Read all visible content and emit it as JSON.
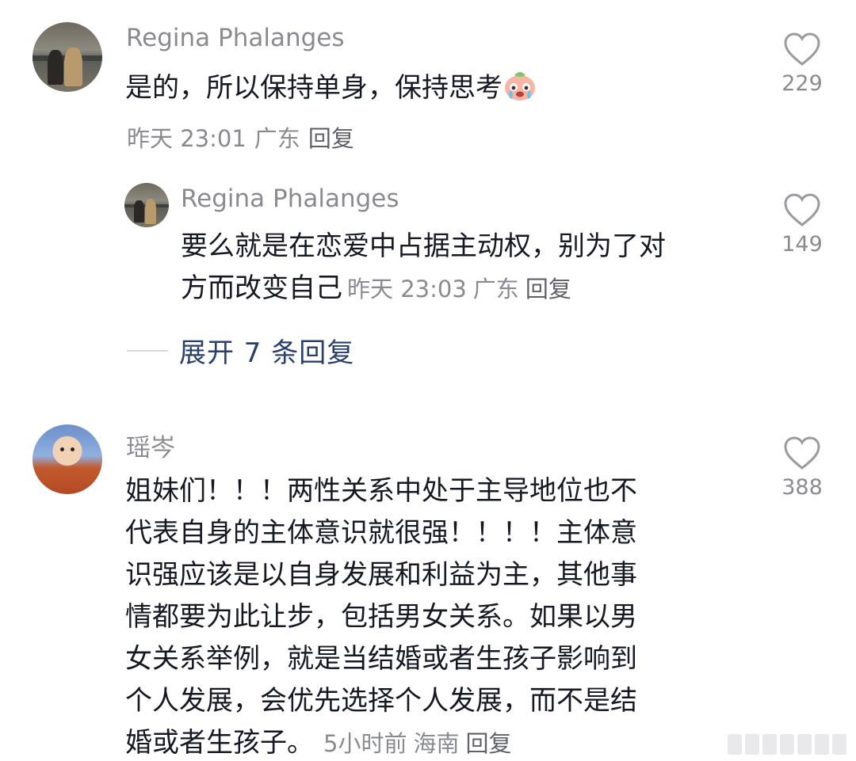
{
  "comments": [
    {
      "username": "Regina Phalanges",
      "text": "是的，所以保持单身，保持思考",
      "emoji": "crying-face-emoji",
      "time": "昨天 23:01",
      "location": "广东",
      "reply_label": "回复",
      "likes": "229",
      "replies": [
        {
          "username": "Regina Phalanges",
          "text_line1": "要么就是在恋爱中占据主动权，别为了对",
          "text_line2": "方而改变自己",
          "time": "昨天 23:03",
          "location": "广东",
          "reply_label": "回复",
          "likes": "149"
        }
      ],
      "expand_label": "展开 7 条回复"
    },
    {
      "username": "瑶岑",
      "text_lines": [
        "姐妹们！！！两性关系中处于主导地位也不",
        "代表自身的主体意识就很强！！！！主体意",
        "识强应该是以自身发展和利益为主，其他事",
        "情都要为此让步，包括男女关系。如果以男",
        "女关系举例，就是当结婚或者生孩子影响到",
        "个人发展，会优先选择个人发展，而不是结",
        "婚或者生孩子。"
      ],
      "time": "5小时前",
      "location": "海南",
      "reply_label": "回复",
      "likes": "388"
    }
  ],
  "colors": {
    "text": "#161823",
    "meta": "#8a8b91",
    "expand": "#29406b",
    "emoji_face": "#f6b5a5"
  }
}
